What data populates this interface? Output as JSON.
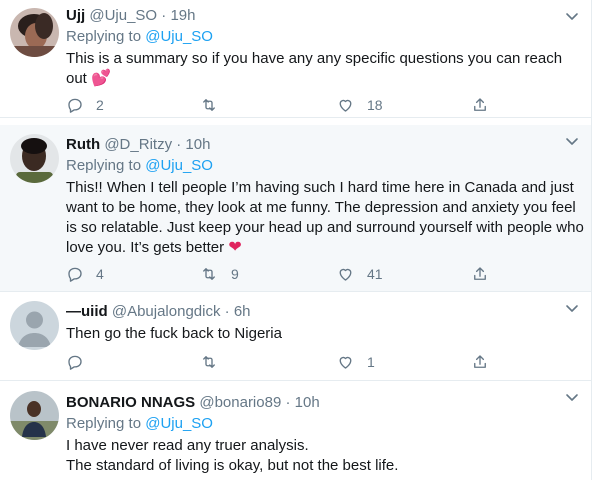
{
  "tweets": [
    {
      "name": "Ujj",
      "handle": "@Uju_SO",
      "dot": "·",
      "time": "19h",
      "reply_prefix": "Replying to",
      "reply_to": "@Uju_SO",
      "text": "This is a summary so if you have any any specific questions you can reach out",
      "emoji": "💕",
      "counts": {
        "replies": "2",
        "retweets": "",
        "likes": "18"
      }
    },
    {
      "name": "Ruth",
      "handle": "@D_Ritzy",
      "dot": "·",
      "time": "10h",
      "reply_prefix": "Replying to",
      "reply_to": "@Uju_SO",
      "text": "This!! When I tell people I’m having such I hard time here in Canada and just want to be home, they look at me funny. The depression and anxiety you feel is so relatable. Just keep your head up and surround yourself with people who love you. It’s gets better",
      "emoji": "❤",
      "counts": {
        "replies": "4",
        "retweets": "9",
        "likes": "41"
      }
    },
    {
      "name": "—uiid",
      "handle": "@Abujalongdick",
      "dot": "·",
      "time": "6h",
      "text": "Then go the fuck back to Nigeria",
      "counts": {
        "replies": "",
        "retweets": "",
        "likes": "1"
      }
    },
    {
      "name": "BONARIO NNAGS",
      "handle": "@bonario89",
      "dot": "·",
      "time": "10h",
      "reply_prefix": "Replying to",
      "reply_to": "@Uju_SO",
      "text_lines": [
        "I have never read any truer analysis.",
        "The standard of living is okay, but not the best life."
      ]
    }
  ],
  "colors": {
    "accent": "#1da1f2",
    "muted": "#657786",
    "highlight_bg": "#f5f8fa",
    "heart": "#e0245e"
  },
  "icons": [
    "reply-icon",
    "retweet-icon",
    "like-icon",
    "share-icon",
    "chevron-down-icon"
  ]
}
